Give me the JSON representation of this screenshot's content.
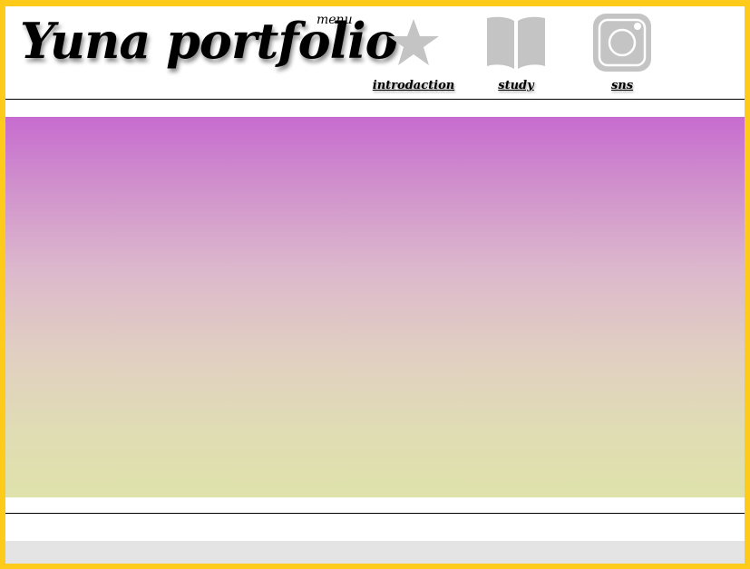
{
  "header": {
    "site_title": "Yuna portfolio",
    "menu_label": "menu"
  },
  "nav": {
    "items": [
      {
        "label": "introdaction",
        "icon": "star-icon"
      },
      {
        "label": "study",
        "icon": "book-icon"
      },
      {
        "label": "sns",
        "icon": "instagram-icon"
      }
    ]
  },
  "colors": {
    "frame_border": "#fecb1a",
    "icon_gray": "#c4c4c4",
    "hero_gradient_top": "#c76cd0",
    "hero_gradient_bottom": "#dfe2ab",
    "footer_bar": "#e4e4e4"
  }
}
